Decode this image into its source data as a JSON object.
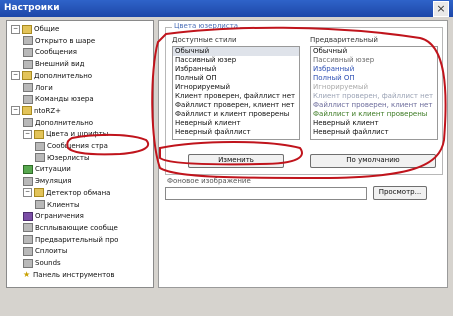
{
  "window": {
    "title": "Настроики",
    "close_glyph": "×"
  },
  "tree": {
    "items": [
      {
        "label": "Общие",
        "level": 0,
        "expander": "−",
        "icon": "folder"
      },
      {
        "label": "Открыто в шаре",
        "level": 1,
        "icon": "doc"
      },
      {
        "label": "Сообщения",
        "level": 1,
        "icon": "doc"
      },
      {
        "label": "Внешний вид",
        "level": 1,
        "icon": "doc"
      },
      {
        "label": "Дополнительно",
        "level": 0,
        "expander": "−",
        "icon": "folder"
      },
      {
        "label": "Логи",
        "level": 1,
        "icon": "doc"
      },
      {
        "label": "Команды юзера",
        "level": 1,
        "icon": "doc"
      },
      {
        "label": "ntoRZ+",
        "level": 0,
        "expander": "−",
        "icon": "folder"
      },
      {
        "label": "Дополнительно",
        "level": 1,
        "icon": "doc"
      },
      {
        "label": "Цвета и шрифты",
        "level": 1,
        "expander": "−",
        "icon": "folder"
      },
      {
        "label": "Сообщения стра",
        "level": 2,
        "icon": "doc"
      },
      {
        "label": "Юзерлисты",
        "level": 2,
        "icon": "doc",
        "selected": true
      },
      {
        "label": "Ситуации",
        "level": 1,
        "icon": "green"
      },
      {
        "label": "Эмуляция",
        "level": 1,
        "icon": "doc"
      },
      {
        "label": "Детектор обмана",
        "level": 1,
        "expander": "−",
        "icon": "folder"
      },
      {
        "label": "Клиенты",
        "level": 2,
        "icon": "doc"
      },
      {
        "label": "Ограничения",
        "level": 1,
        "icon": "purple"
      },
      {
        "label": "Всплывающие сообще",
        "level": 1,
        "icon": "doc"
      },
      {
        "label": "Предварительный про",
        "level": 1,
        "icon": "doc"
      },
      {
        "label": "Сплоиты",
        "level": 1,
        "icon": "doc"
      },
      {
        "label": "Sounds",
        "level": 1,
        "icon": "doc"
      },
      {
        "label": "Панель инструментов",
        "level": 1,
        "icon": "star"
      }
    ]
  },
  "group": {
    "title": "Цвета юзерлиста",
    "left_header": "Доступные стили",
    "right_header": "Предварительный",
    "styles": [
      "Обычный",
      "Пассивный юзер",
      "Избранный",
      "Полный ОП",
      "Игнорируемый",
      "Клиент проверен, файллист нет",
      "Файллист проверен, клиент нет",
      "Файллист и клиент проверены",
      "Неверный клиент",
      "Неверный файллист"
    ],
    "preview": [
      {
        "label": "Обычный",
        "color": "#111111"
      },
      {
        "label": "Пассивный юзер",
        "color": "#6b6b6b"
      },
      {
        "label": "Избранный",
        "color": "#2d4fb3"
      },
      {
        "label": "Полный ОП",
        "color": "#2d4fb3"
      },
      {
        "label": "Игнорируемый",
        "color": "#a9a9a9"
      },
      {
        "label": "Клиент проверен, файллист нет",
        "color": "#9aa2b4"
      },
      {
        "label": "Файллист проверен, клиент нет",
        "color": "#6a6a9a"
      },
      {
        "label": "Файллист и клиент проверены",
        "color": "#3b7a22"
      },
      {
        "label": "Неверный клиент",
        "color": "#111111"
      },
      {
        "label": "Неверный файллист",
        "color": "#111111"
      }
    ],
    "change_button": "Изменить",
    "default_button": "По умолчанию"
  },
  "image": {
    "label": "Фоновое изображение",
    "value": "",
    "browse_button": "Просмотр..."
  },
  "annotation_color": "#c0141c"
}
